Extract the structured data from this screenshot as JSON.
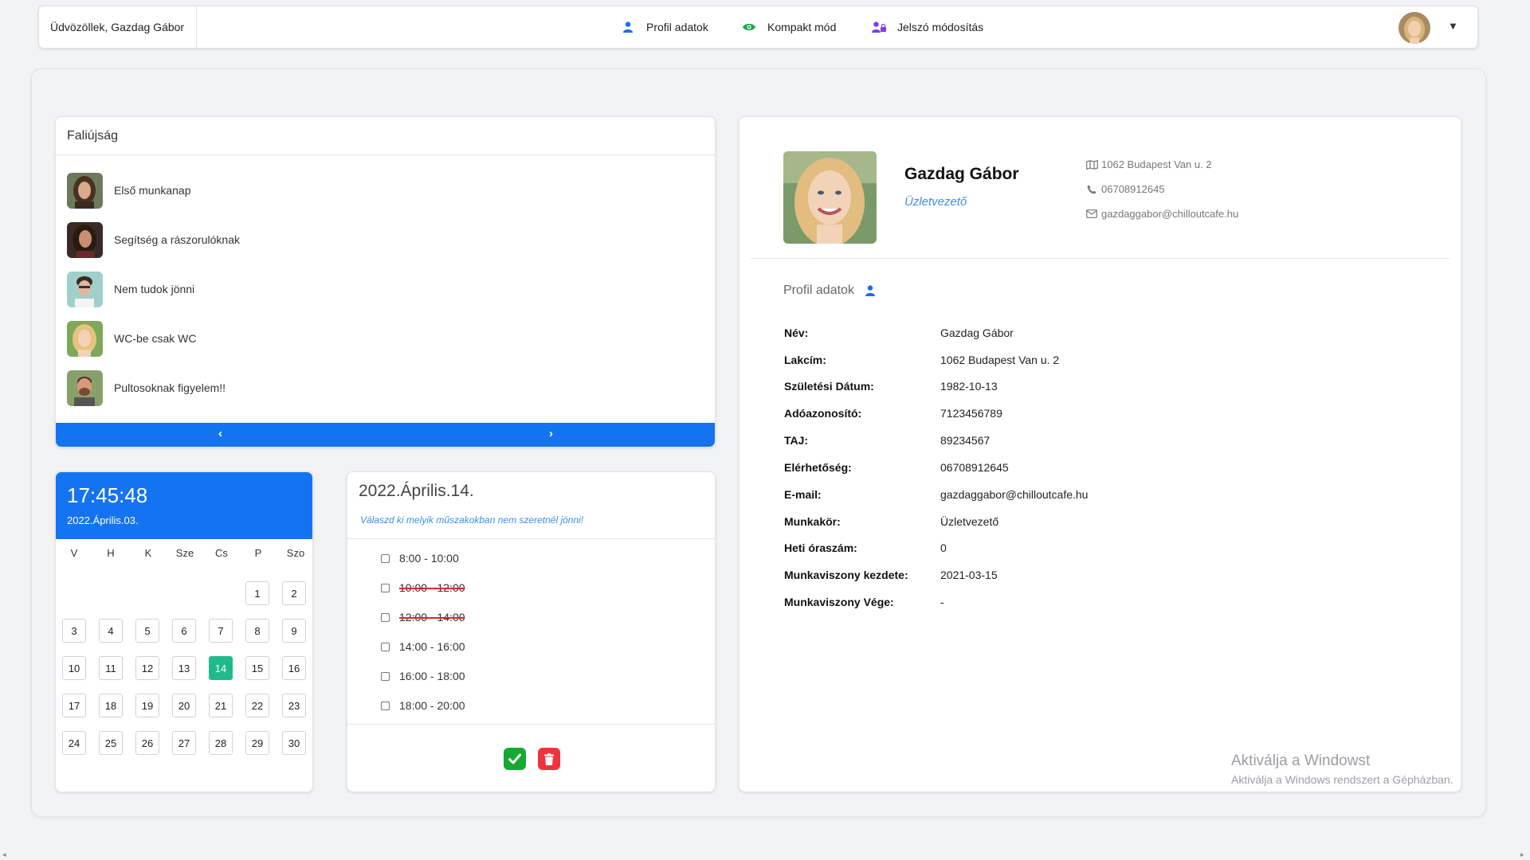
{
  "topbar": {
    "greeting": "Üdvözöllek, Gazdag Gábor",
    "nav": [
      {
        "label": "Profil adatok",
        "icon": "user-icon",
        "color": "#1a6fe8"
      },
      {
        "label": "Kompakt mód",
        "icon": "eye-icon",
        "color": "#19a84a"
      },
      {
        "label": "Jelszó módosítás",
        "icon": "user-lock-icon",
        "color": "#7b3fe4"
      }
    ],
    "menu_caret": "▼"
  },
  "wall": {
    "title": "Faliújság",
    "posts": [
      {
        "title": "Első munkanap"
      },
      {
        "title": "Segítség a rászorulóknak"
      },
      {
        "title": "Nem tudok jönni"
      },
      {
        "title": "WC-be csak WC"
      },
      {
        "title": "Pultosoknak figyelem!!"
      }
    ],
    "prev": "‹",
    "next": "›"
  },
  "calendar": {
    "time": "17:45:48",
    "date": "2022.Április.03.",
    "weekdays": [
      "V",
      "H",
      "K",
      "Sze",
      "Cs",
      "P",
      "Szo"
    ],
    "selected_day": "14",
    "accent": "#1473f0",
    "selected_color": "#1fba8c"
  },
  "shifts": {
    "title": "2022.Április.14.",
    "hint": "Válaszd ki melyik műszakokban nem szeretnél jönni!",
    "slots": [
      {
        "label": "8:00 - 10:00",
        "struck": false
      },
      {
        "label": "10:00 - 12:00",
        "struck": true
      },
      {
        "label": "12:00 - 14:00",
        "struck": true
      },
      {
        "label": "14:00 - 16:00",
        "struck": false
      },
      {
        "label": "16:00 - 18:00",
        "struck": false
      },
      {
        "label": "18:00 - 20:00",
        "struck": false
      }
    ]
  },
  "profile": {
    "name": "Gazdag Gábor",
    "role": "Üzletvezető",
    "address": "1062 Budapest Van u. 2",
    "phone": "06708912645",
    "email": "gazdaggabor@chilloutcafe.hu",
    "section_title": "Profil adatok",
    "fields": [
      {
        "key": "Név:",
        "value": "Gazdag Gábor"
      },
      {
        "key": "Lakcím:",
        "value": "1062 Budapest Van u. 2"
      },
      {
        "key": "Születési Dátum:",
        "value": "1982-10-13"
      },
      {
        "key": "Adóazonosító:",
        "value": "7123456789"
      },
      {
        "key": "TAJ:",
        "value": "89234567"
      },
      {
        "key": "Elérhetőség:",
        "value": "06708912645"
      },
      {
        "key": "E-mail:",
        "value": "gazdaggabor@chilloutcafe.hu"
      },
      {
        "key": "Munkakör:",
        "value": "Üzletvezető"
      },
      {
        "key": "Heti óraszám:",
        "value": "0"
      },
      {
        "key": "Munkaviszony kezdete:",
        "value": "2021-03-15"
      },
      {
        "key": "Munkaviszony Vége:",
        "value": "-"
      }
    ]
  },
  "watermark": {
    "line1": "Aktiválja a Windowst",
    "line2": "Aktiválja a Windows rendszert a Gépházban."
  }
}
